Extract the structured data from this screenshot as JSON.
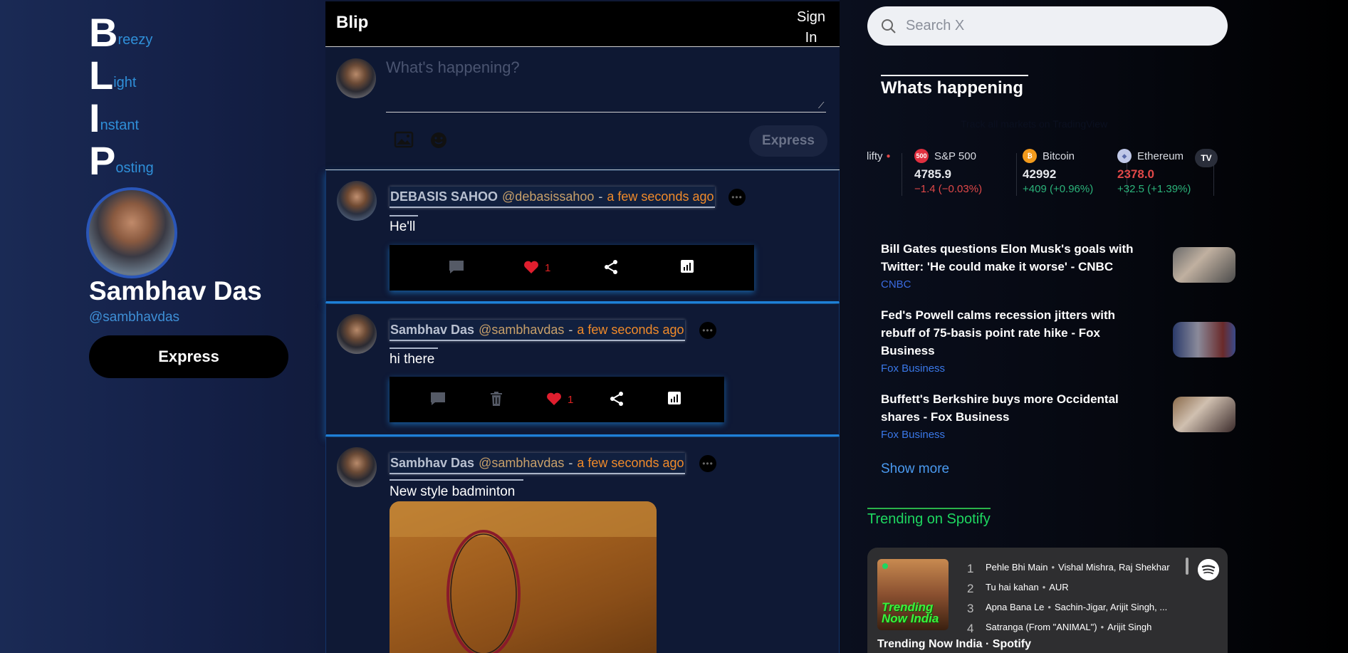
{
  "sidebar": {
    "acronym": [
      {
        "letter": "B",
        "rest": "reezy"
      },
      {
        "letter": "L",
        "rest": "ight"
      },
      {
        "letter": "I",
        "rest": "nstant"
      },
      {
        "letter": "P",
        "rest": "osting"
      }
    ],
    "profile_name": "Sambhav Das",
    "profile_handle": "@sambhavdas",
    "express_label": "Express"
  },
  "header": {
    "brand": "Blip",
    "signin_line1": "Sign",
    "signin_line2": "In"
  },
  "composer": {
    "placeholder": "What's happening?",
    "express_label": "Express"
  },
  "posts": [
    {
      "name": "DEBASIS SAHOO",
      "handle": "@debasissahoo",
      "dash": "-",
      "time": "a few seconds ago",
      "text": "He'll",
      "likes": "1"
    },
    {
      "name": "Sambhav Das",
      "handle": "@sambhavdas",
      "dash": "-",
      "time": "a few seconds ago",
      "text": "hi there",
      "likes": "1"
    },
    {
      "name": "Sambhav Das",
      "handle": "@sambhavdas",
      "dash": "-",
      "time": "a few seconds ago",
      "text": "New style badminton"
    }
  ],
  "search": {
    "placeholder": "Search X"
  },
  "whats_happening": {
    "title": "Whats happening",
    "tv_caption": "Track all markets on TradingView",
    "tickers": [
      {
        "name": "lifty",
        "price": "",
        "change": ""
      },
      {
        "name": "S&P 500",
        "badge": "500",
        "price": "4785.9",
        "change": "−1.4 (−0.03%)",
        "direction": "down",
        "color": "#e03040"
      },
      {
        "name": "Bitcoin",
        "badge": "₿",
        "price": "42992",
        "change": "+409 (+0.96%)",
        "direction": "up",
        "color": "#f29a1c"
      },
      {
        "name": "Ethereum",
        "badge": "◆",
        "price": "2378.0",
        "change": "+32.5 (+1.39%)",
        "direction": "up",
        "color": "#c0c8e8"
      }
    ],
    "news": [
      {
        "title": "Bill Gates questions Elon Musk's goals with Twitter: 'He could make it worse' - CNBC",
        "source": "CNBC"
      },
      {
        "title": "Fed's Powell calms recession jitters with rebuff of 75-basis point rate hike - Fox Business",
        "source": "Fox Business"
      },
      {
        "title": "Buffett's Berkshire buys more Occidental shares - Fox Business",
        "source": "Fox Business"
      }
    ],
    "show_more": "Show more"
  },
  "spotify": {
    "title": "Trending on Spotify",
    "cover_text": "Trending Now India",
    "tracks": [
      {
        "num": "1",
        "name": "Pehle Bhi Main",
        "artist": "Vishal Mishra, Raj Shekhar"
      },
      {
        "num": "2",
        "name": "Tu hai kahan",
        "artist": "AUR"
      },
      {
        "num": "3",
        "name": "Apna Bana Le",
        "artist": "Sachin-Jigar, Arijit Singh, ..."
      },
      {
        "num": "4",
        "name": "Satranga (From \"ANIMAL\")",
        "artist": "Arijit Singh"
      }
    ],
    "footer": "Trending Now India · Spotify"
  },
  "colors": {
    "accent_blue": "#1f7fd6",
    "time_orange": "#f08a2a",
    "like_red": "#d22222",
    "spotify_green": "#1ed760"
  }
}
